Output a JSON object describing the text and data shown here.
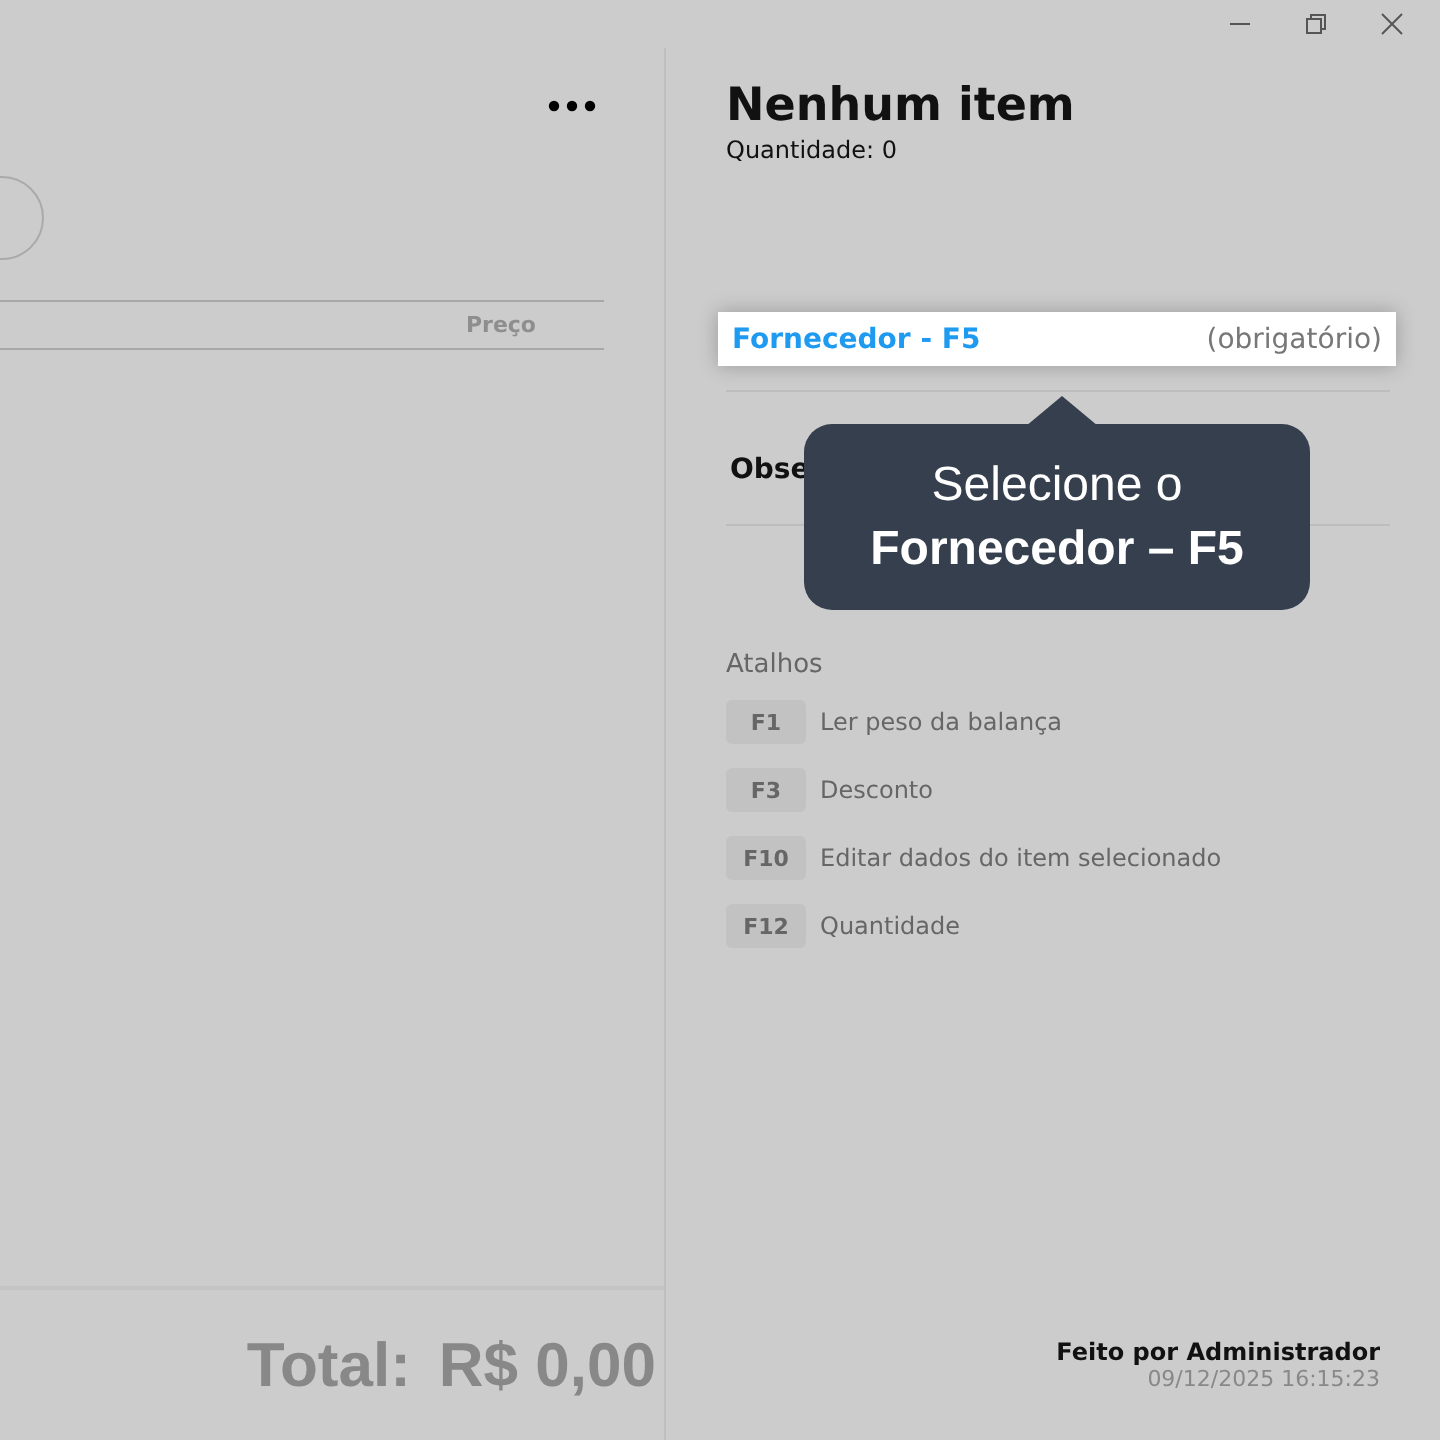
{
  "window": {
    "controls": [
      {
        "kind": "minimize"
      },
      {
        "kind": "restore"
      },
      {
        "kind": "close"
      }
    ]
  },
  "items_panel": {
    "columns": [
      "Preço"
    ],
    "total_label": "Total:",
    "total_value": "R$ 0,00"
  },
  "summary": {
    "title": "Nenhum item",
    "quantity": "Quantidade: 0"
  },
  "supplier_field": {
    "label": "Fornecedor - F5",
    "hint": "(obrigatório)"
  },
  "notes_field": {
    "label": "Obse"
  },
  "tooltip": {
    "line_1": "Selecione o",
    "line_2": "Fornecedor – F5"
  },
  "shortcuts": {
    "title": "Atalhos",
    "items": [
      {
        "key": "F1",
        "label": "Ler peso da balança"
      },
      {
        "key": "F3",
        "label": "Desconto"
      },
      {
        "key": "F10",
        "label": "Editar dados do item selecionado"
      },
      {
        "key": "F12",
        "label": "Quantidade"
      }
    ]
  },
  "footer": {
    "author": "Feito por Administrador",
    "timestamp": "09/12/2025 16:15:23"
  }
}
